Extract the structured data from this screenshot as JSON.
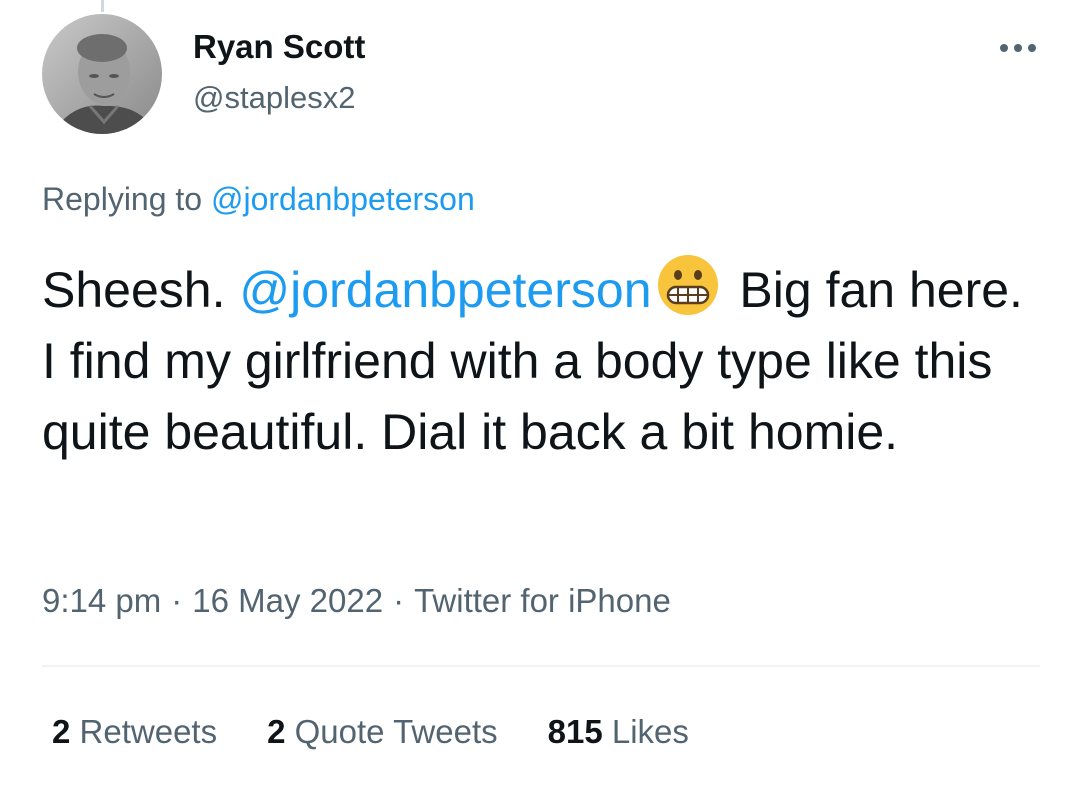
{
  "author": {
    "display_name": "Ryan Scott",
    "handle": "@staplesx2",
    "avatar_icon": "profile-photo-avatar"
  },
  "more_icon": "more-options-icon",
  "reply": {
    "prefix": "Replying to",
    "mention": "@jordanbpeterson"
  },
  "tweet": {
    "text_start": "Sheesh. ",
    "mention": "@jordanbpeterson",
    "emoji_icon": "grimacing-face-emoji",
    "text_end": " Big fan here. I find my girlfriend with a body type like this quite beautiful. Dial it back a bit homie."
  },
  "meta": {
    "time": "9:14 pm",
    "separator": "·",
    "date": "16 May 2022",
    "source": "Twitter for iPhone"
  },
  "stats": {
    "retweets_count": "2",
    "retweets_label": "Retweets",
    "quotes_count": "2",
    "quotes_label": "Quote Tweets",
    "likes_count": "815",
    "likes_label": "Likes"
  },
  "colors": {
    "link": "#1d9bf0",
    "secondary_text": "#536471",
    "primary_text": "#0f1419",
    "emoji_yellow": "#f7c43b"
  }
}
